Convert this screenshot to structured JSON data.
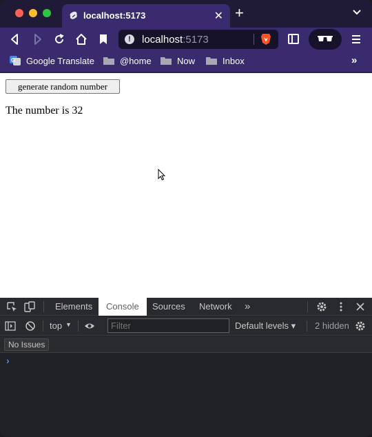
{
  "browser": {
    "tab": {
      "title": "localhost:5173",
      "close": "✕"
    },
    "new_tab": "+",
    "address": {
      "host": "localhost",
      "port": ":5173"
    },
    "bookmarks": [
      {
        "label": "Google Translate",
        "icon": "google-translate-icon"
      },
      {
        "label": "@home",
        "icon": "folder-icon"
      },
      {
        "label": "Now",
        "icon": "folder-icon"
      },
      {
        "label": "Inbox",
        "icon": "folder-icon"
      }
    ],
    "bookmarks_overflow": "»"
  },
  "page": {
    "generate_button": "generate random number",
    "number_text": "The number is 32"
  },
  "devtools": {
    "tabs": [
      "Elements",
      "Console",
      "Sources",
      "Network"
    ],
    "active_tab": "Console",
    "more_tabs": "»",
    "context": "top",
    "context_arrow": "▼",
    "filter_placeholder": "Filter",
    "levels": "Default levels ▾",
    "hidden": "2 hidden",
    "issues": "No Issues",
    "prompt": "›"
  },
  "colors": {
    "tab_strip": "#1f1a36",
    "toolbar": "#3a2a6e",
    "devtools_bg": "#202124",
    "console_prompt": "#4b8bf5"
  }
}
